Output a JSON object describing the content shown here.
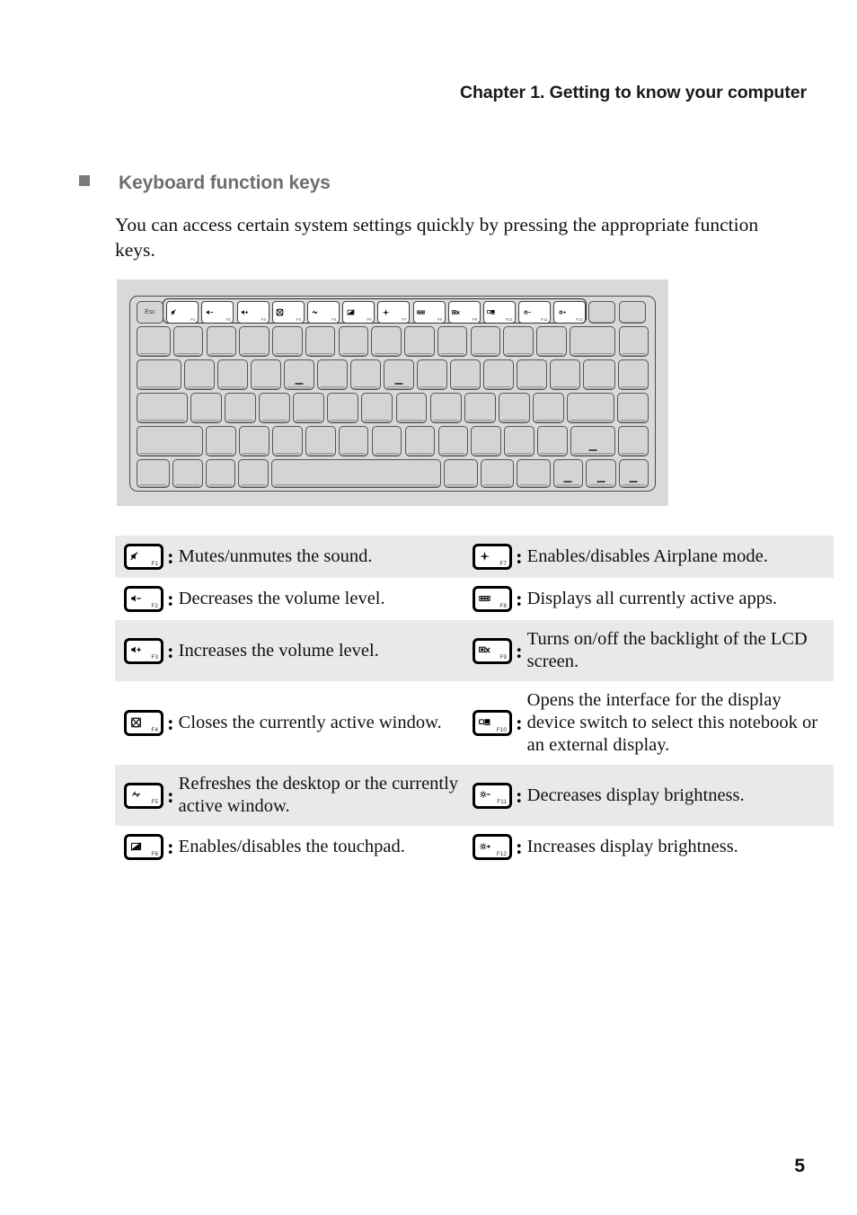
{
  "header": {
    "chapter_title": "Chapter 1. Getting to know your computer"
  },
  "section": {
    "bullet_icon": "filled-square-bullet",
    "title": "Keyboard function keys",
    "intro": "You can access certain system settings quickly by pressing the appropriate function keys."
  },
  "keyboard_figure": {
    "esc_label": "Esc",
    "function_keys": [
      {
        "fn": "F1",
        "icon": "mute-icon"
      },
      {
        "fn": "F2",
        "icon": "volume-down-icon"
      },
      {
        "fn": "F3",
        "icon": "volume-up-icon"
      },
      {
        "fn": "F4",
        "icon": "close-window-icon"
      },
      {
        "fn": "F5",
        "icon": "refresh-icon"
      },
      {
        "fn": "F6",
        "icon": "touchpad-disable-icon"
      },
      {
        "fn": "F7",
        "icon": "airplane-mode-icon"
      },
      {
        "fn": "F8",
        "icon": "task-view-icon"
      },
      {
        "fn": "F9",
        "icon": "lcd-backlight-off-icon"
      },
      {
        "fn": "F10",
        "icon": "display-switch-icon"
      },
      {
        "fn": "F11",
        "icon": "brightness-down-icon"
      },
      {
        "fn": "F12",
        "icon": "brightness-up-icon"
      }
    ]
  },
  "fn_table": {
    "separator": ":",
    "rows": [
      {
        "shaded": true,
        "left": {
          "fn": "F1",
          "icon": "mute-icon",
          "desc": "Mutes/unmutes the sound."
        },
        "right": {
          "fn": "F7",
          "icon": "airplane-mode-icon",
          "desc": "Enables/disables Airplane mode."
        }
      },
      {
        "shaded": false,
        "left": {
          "fn": "F2",
          "icon": "volume-down-icon",
          "desc": "Decreases the volume level."
        },
        "right": {
          "fn": "F8",
          "icon": "task-view-icon",
          "desc": "Displays all currently active apps."
        }
      },
      {
        "shaded": true,
        "left": {
          "fn": "F3",
          "icon": "volume-up-icon",
          "desc": "Increases the volume level."
        },
        "right": {
          "fn": "F9",
          "icon": "lcd-backlight-off-icon",
          "desc": "Turns on/off the backlight of the LCD screen."
        }
      },
      {
        "shaded": false,
        "left": {
          "fn": "F4",
          "icon": "close-window-icon",
          "desc": "Closes the currently active window."
        },
        "right": {
          "fn": "F10",
          "icon": "display-switch-icon",
          "desc": "Opens the interface for the display device switch to select this notebook or an external display."
        }
      },
      {
        "shaded": true,
        "left": {
          "fn": "F5",
          "icon": "refresh-icon",
          "desc": "Refreshes the desktop or the currently active window."
        },
        "right": {
          "fn": "F11",
          "icon": "brightness-down-icon",
          "desc": "Decreases display brightness."
        }
      },
      {
        "shaded": false,
        "left": {
          "fn": "F6",
          "icon": "touchpad-disable-icon",
          "desc": "Enables/disables the touchpad."
        },
        "right": {
          "fn": "F12",
          "icon": "brightness-up-icon",
          "desc": "Increases display brightness."
        }
      }
    ]
  },
  "footer": {
    "page_number": "5"
  }
}
